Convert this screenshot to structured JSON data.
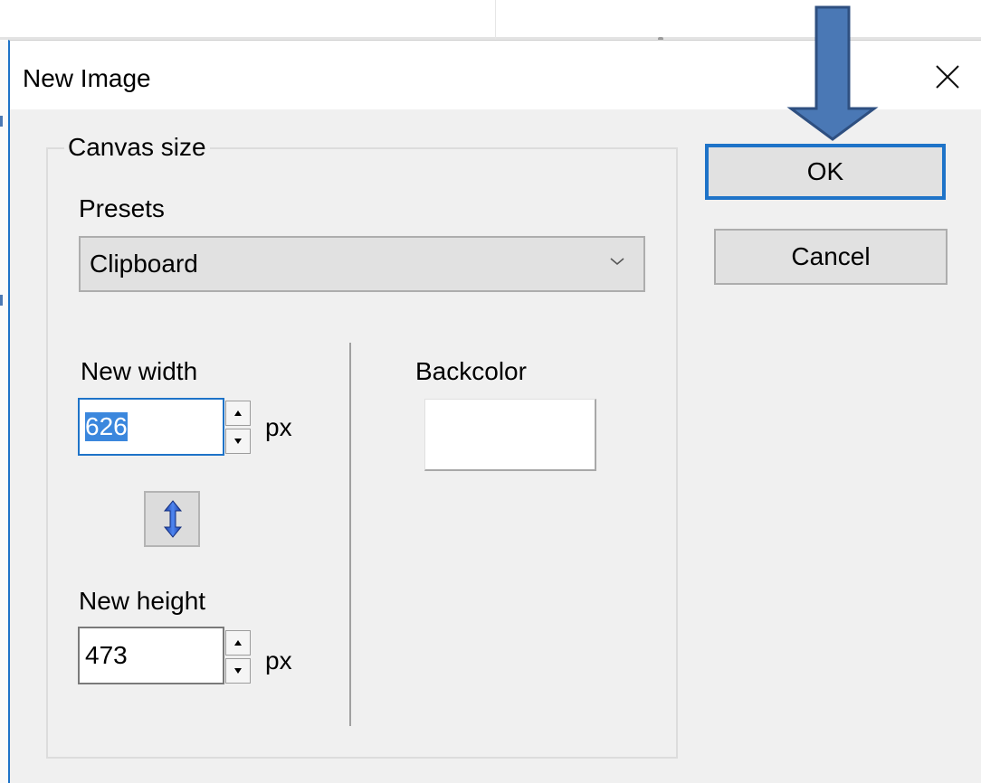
{
  "dialog": {
    "title": "New Image",
    "close_icon": "close-icon"
  },
  "canvas_size": {
    "group_label": "Canvas size",
    "presets_label": "Presets",
    "presets_value": "Clipboard",
    "width_label": "New width",
    "width_value": "626",
    "width_unit": "px",
    "height_label": "New height",
    "height_value": "473",
    "height_unit": "px",
    "backcolor_label": "Backcolor",
    "backcolor_value": "#ffffff"
  },
  "buttons": {
    "ok_label": "OK",
    "cancel_label": "Cancel"
  },
  "annotation": {
    "arrow_color": "#4a78b5",
    "arrow_icon": "down-arrow-annotation"
  },
  "colors": {
    "accent": "#1e73c8",
    "dialog_bg": "#f0f0f0",
    "selection": "#3b87dd"
  }
}
